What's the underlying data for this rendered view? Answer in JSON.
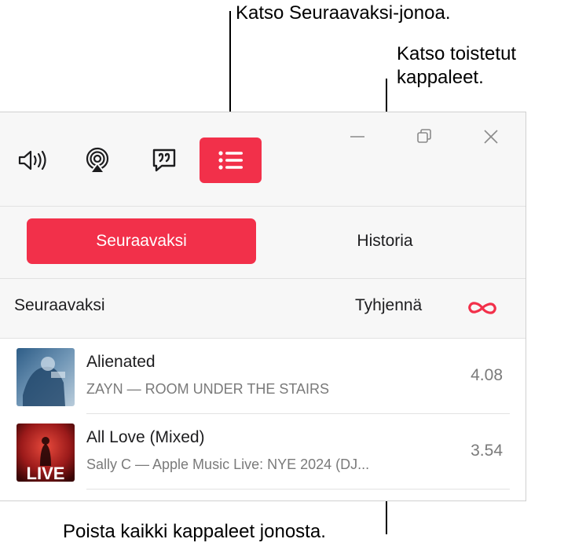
{
  "callouts": {
    "queue": "Katso Seuraavaksi-jonoa.",
    "history_line1": "Katso toistetut",
    "history_line2": "kappaleet.",
    "clear": "Poista kaikki kappaleet jonosta."
  },
  "toolbar": {
    "icons": [
      "volume-icon",
      "airplay-icon",
      "lyrics-icon",
      "queue-list-icon"
    ],
    "active_icon": "queue-list-icon",
    "window_controls": [
      "minimize",
      "restore",
      "close"
    ]
  },
  "tabs": {
    "upnext_label": "Seuraavaksi",
    "history_label": "Historia",
    "selected": "Seuraavaksi"
  },
  "queue": {
    "title": "Seuraavaksi",
    "clear_label": "Tyhjennä",
    "autoplay_icon": "infinity-icon"
  },
  "tracks": [
    {
      "title": "Alienated",
      "subtitle": "ZAYN — ROOM UNDER THE STAIRS",
      "duration": "4.08"
    },
    {
      "title": "All Love (Mixed)",
      "subtitle": "Sally C — Apple Music Live: NYE 2024 (DJ...",
      "duration": "3.54",
      "art_text": "LIVE"
    }
  ],
  "colors": {
    "accent": "#f2304a",
    "toolbar_bg": "#f7f7f7",
    "secondary_text": "#7a7a7a"
  }
}
